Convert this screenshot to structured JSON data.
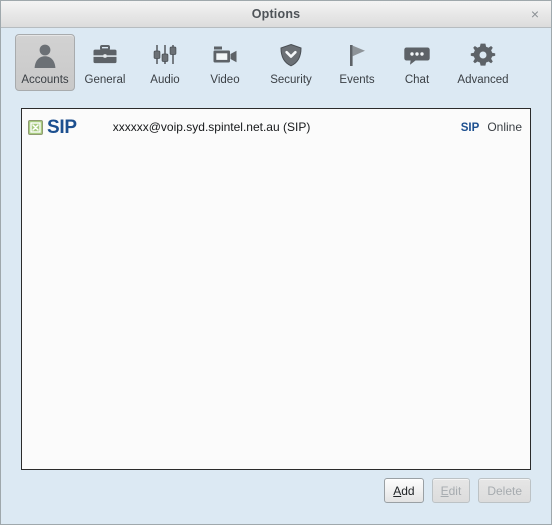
{
  "window": {
    "title": "Options",
    "close_label": "×"
  },
  "toolbar": {
    "items": [
      {
        "label": "Accounts",
        "icon": "person-icon",
        "selected": true
      },
      {
        "label": "General",
        "icon": "briefcase-icon",
        "selected": false
      },
      {
        "label": "Audio",
        "icon": "sliders-icon",
        "selected": false
      },
      {
        "label": "Video",
        "icon": "camcorder-icon",
        "selected": false
      },
      {
        "label": "Security",
        "icon": "shield-icon",
        "selected": false
      },
      {
        "label": "Events",
        "icon": "flag-icon",
        "selected": false
      },
      {
        "label": "Chat",
        "icon": "speech-bubble-icon",
        "selected": false
      },
      {
        "label": "Advanced",
        "icon": "gear-icon",
        "selected": false
      }
    ]
  },
  "accounts": {
    "rows": [
      {
        "enabled_icon": "enabled-checkbox-icon",
        "protocol": "SIP",
        "name": "xxxxxx@voip.syd.spintel.net.au (SIP)",
        "right_protocol": "SIP",
        "status": "Online"
      }
    ]
  },
  "buttons": {
    "add": {
      "prefix": "A",
      "rest": "dd",
      "enabled": true
    },
    "edit": {
      "prefix": "E",
      "rest": "dit",
      "enabled": false
    },
    "delete": {
      "prefix": "",
      "rest": "Delete",
      "enabled": false
    }
  },
  "colors": {
    "window_bg": "#dce9f3",
    "titlebar_bg": "#e9e9e9",
    "panel_bg": "#fbfbfb",
    "protocol_blue": "#1c4f8f",
    "badge_green": "#a7ca7e",
    "icon_gray": "#5d6267",
    "text_dark": "#3a3f44"
  }
}
